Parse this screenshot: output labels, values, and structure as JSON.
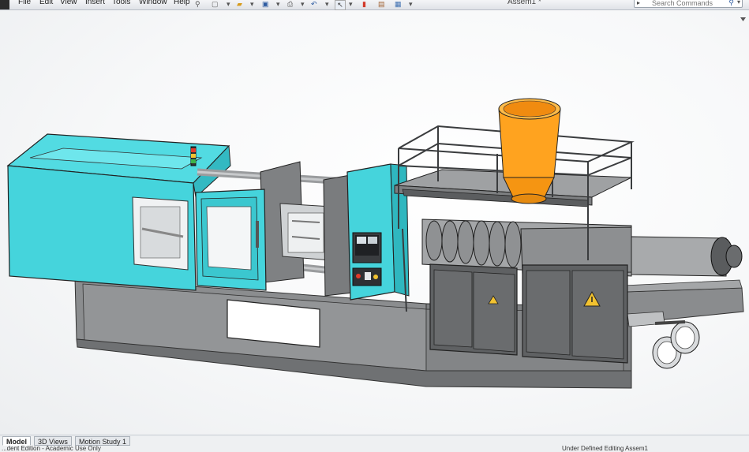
{
  "app": {
    "document_title": "Assem1 *"
  },
  "menu": {
    "items": [
      "File",
      "Edit",
      "View",
      "Insert",
      "Tools",
      "Window",
      "Help"
    ]
  },
  "search": {
    "placeholder": "Search Commands"
  },
  "tabs": [
    "Model",
    "3D Views",
    "Motion Study 1"
  ],
  "status": {
    "left": "...dent Edition - Academic Use Only",
    "right": "Under Defined   Editing Assem1"
  },
  "colors": {
    "machine_cyan": "#45d4dc",
    "hopper_orange": "#ffa31f",
    "base_gray": "#8c8e90"
  }
}
